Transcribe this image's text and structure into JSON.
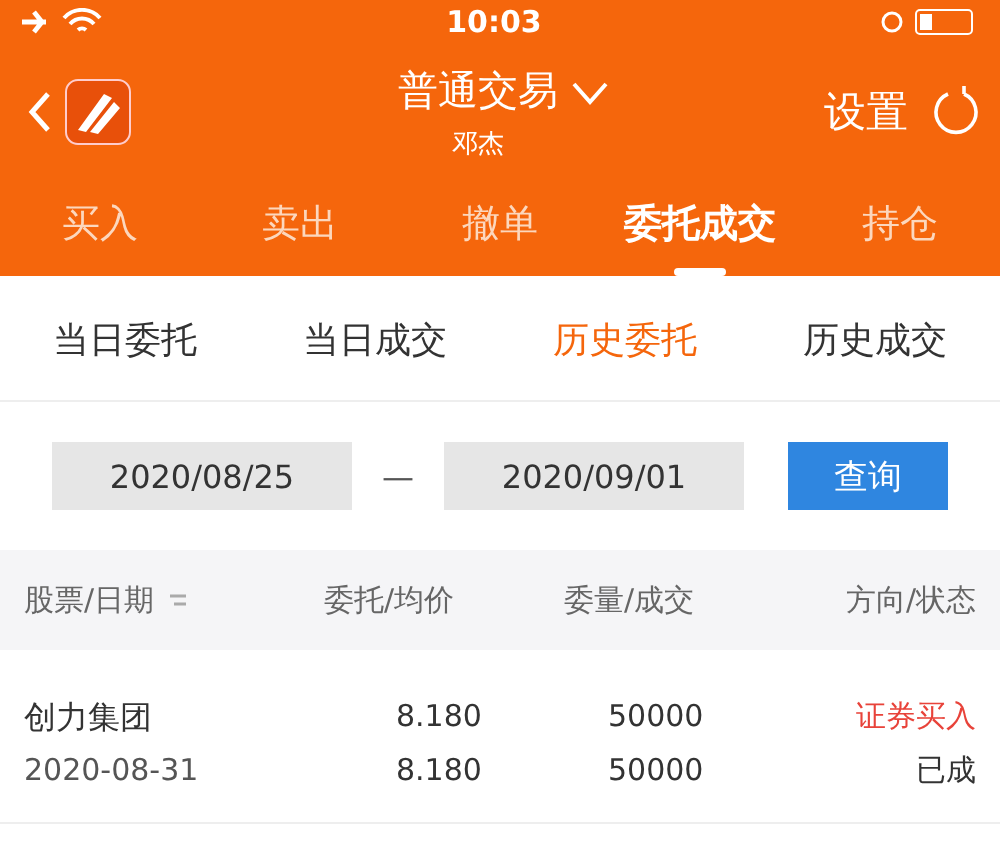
{
  "status_bar": {
    "time": "10:03"
  },
  "header": {
    "title": "普通交易",
    "subtitle": "邓杰",
    "settings": "设置"
  },
  "tabs": [
    {
      "label": "买入",
      "selected": false
    },
    {
      "label": "卖出",
      "selected": false
    },
    {
      "label": "撤单",
      "selected": false
    },
    {
      "label": "委托成交",
      "selected": true
    },
    {
      "label": "持仓",
      "selected": false
    }
  ],
  "sub_tabs": [
    {
      "label": "当日委托",
      "selected": false
    },
    {
      "label": "当日成交",
      "selected": false
    },
    {
      "label": "历史委托",
      "selected": true
    },
    {
      "label": "历史成交",
      "selected": false
    }
  ],
  "date_range": {
    "start": "2020/08/25",
    "separator": "—",
    "end": "2020/09/01",
    "query_button": "查询"
  },
  "table": {
    "columns": [
      "股票/日期",
      "委托/均价",
      "委量/成交",
      "方向/状态"
    ],
    "rows": [
      {
        "name": "创力集团",
        "date": "2020-08-31",
        "price": "8.180",
        "avg_price": "8.180",
        "volume": "50000",
        "filled": "50000",
        "direction": "证券买入",
        "status": "已成"
      }
    ]
  }
}
